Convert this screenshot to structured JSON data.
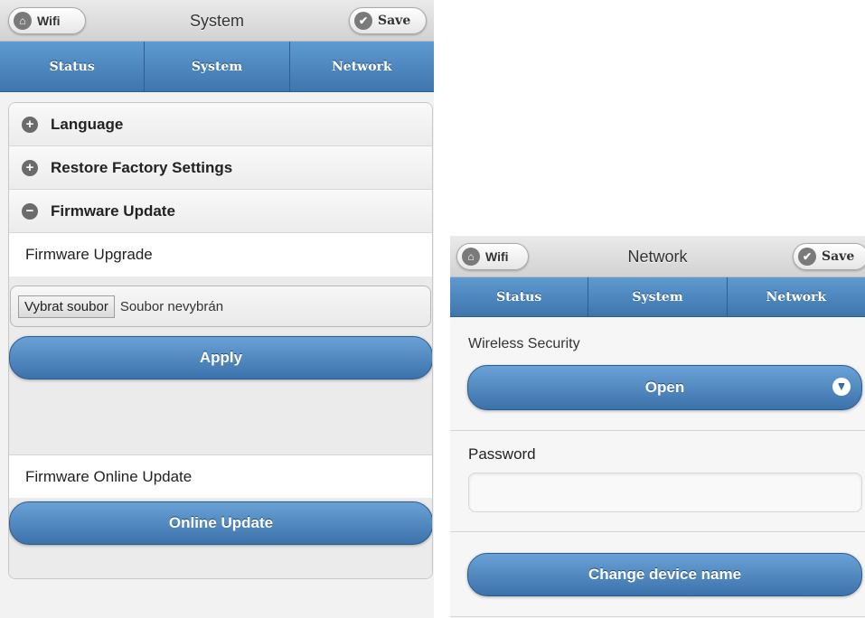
{
  "left_screen": {
    "header": {
      "title": "System",
      "back_label": "Wifi",
      "save_label": "Save"
    },
    "nav_tabs": [
      {
        "label": "Status"
      },
      {
        "label": "System"
      },
      {
        "label": "Network"
      }
    ],
    "sections": [
      {
        "label": "Language",
        "state": "collapsed"
      },
      {
        "label": "Restore Factory Settings",
        "state": "collapsed"
      },
      {
        "label": "Firmware Update",
        "state": "expanded"
      }
    ],
    "firmware": {
      "upgrade_label": "Firmware Upgrade",
      "choose_file_button": "Vybrat soubor",
      "no_file_text": "Soubor nevybrán",
      "apply_button": "Apply",
      "online_label": "Firmware Online Update",
      "online_button": "Online Update"
    }
  },
  "right_screen": {
    "header": {
      "title": "Network",
      "back_label": "Wifi",
      "save_label": "Save"
    },
    "nav_tabs": [
      {
        "label": "Status"
      },
      {
        "label": "System"
      },
      {
        "label": "Network"
      }
    ],
    "wireless_security_label": "Wireless Security",
    "security_select_value": "Open",
    "password_label": "Password",
    "password_value": "",
    "change_name_button": "Change device name"
  },
  "colors": {
    "nav_blue_top": "#5e9ad1",
    "nav_blue_bottom": "#3f75ad",
    "button_blue": "#4a82bb",
    "header_gray": "#dcdcdc",
    "icon_gray": "#6b6b6b"
  },
  "icons": {
    "back": "home-icon",
    "save": "check-icon",
    "collapsed": "plus-circle-icon",
    "expanded": "minus-circle-icon",
    "dropdown": "chevron-down-icon"
  }
}
